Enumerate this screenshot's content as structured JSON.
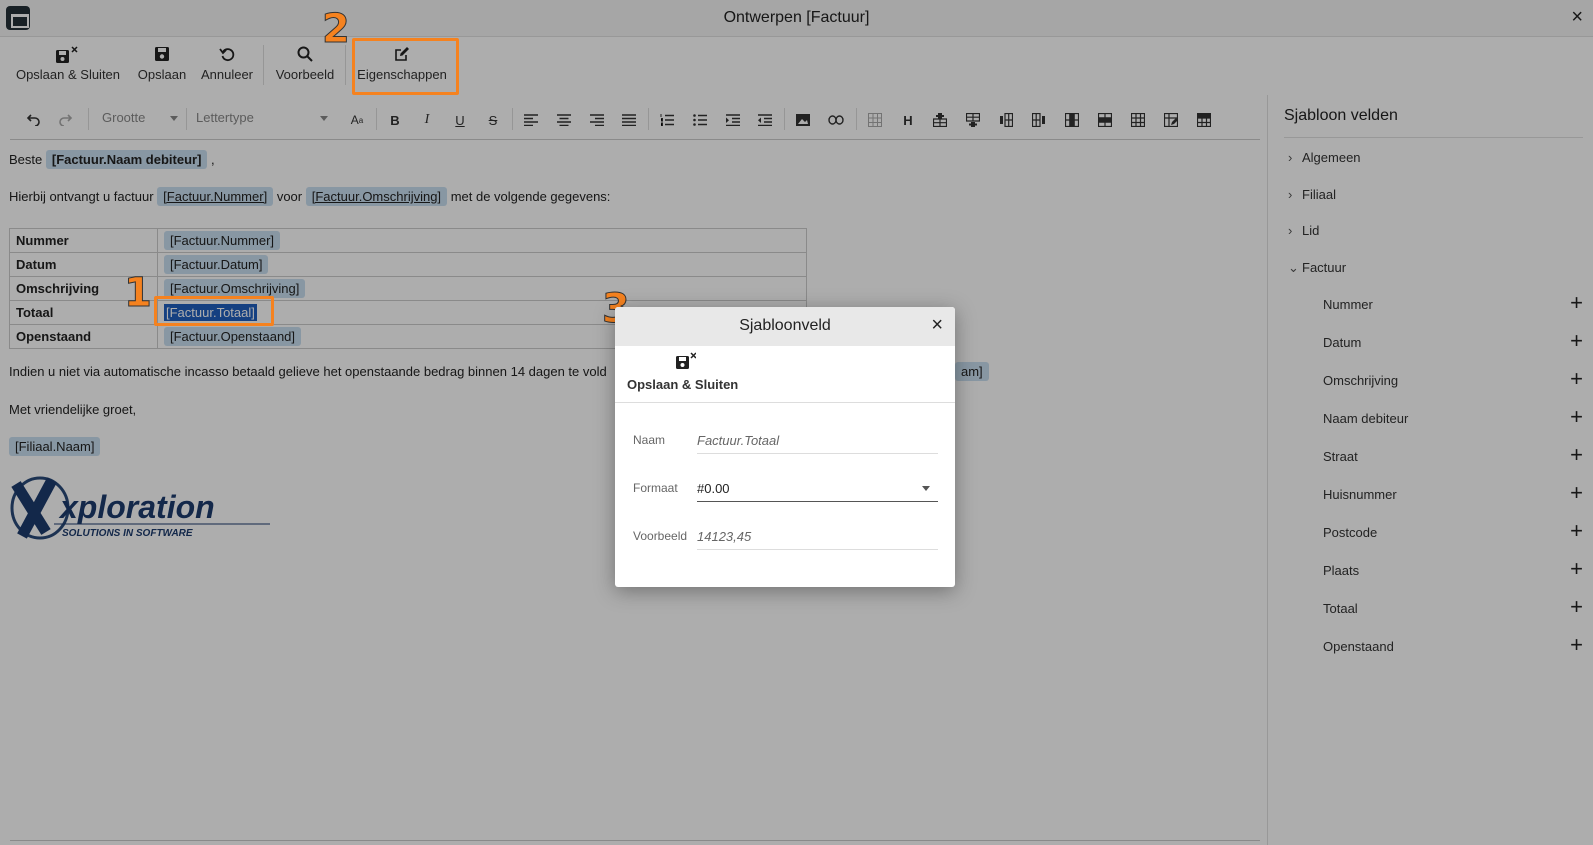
{
  "window": {
    "title": "Ontwerpen [Factuur]",
    "close": "×"
  },
  "toolbar": {
    "save_close": "Opslaan & Sluiten",
    "save": "Opslaan",
    "cancel": "Annuleer",
    "preview": "Voorbeeld",
    "properties": "Eigenschappen"
  },
  "editor": {
    "size_placeholder": "Grootte",
    "font_placeholder": "Lettertype"
  },
  "document": {
    "greeting": "Beste",
    "greeting_field": "[Factuur.Naam debiteur]",
    "greeting_end": ",",
    "line2_a": "Hierbij ontvangt u factuur",
    "line2_field1": "[Factuur.Nummer]",
    "line2_b": "voor",
    "line2_field2": "[Factuur.Omschrijving]",
    "line2_c": "met de volgende gegevens:",
    "table": [
      {
        "label": "Nummer",
        "field": "[Factuur.Nummer]"
      },
      {
        "label": "Datum",
        "field": "[Factuur.Datum]"
      },
      {
        "label": "Omschrijving",
        "field": "[Factuur.Omschrijving]"
      },
      {
        "label": "Totaal",
        "field": "[Factuur.Totaal]"
      },
      {
        "label": "Openstaand",
        "field": "[Factuur.Openstaand]"
      }
    ],
    "line3": "Indien u niet via automatische incasso betaald gelieve het openstaande bedrag binnen 14 dagen te vold",
    "line3_tail": "am]",
    "closing": "Met vriendelijke groet,",
    "signature_field": "[Filiaal.Naam]",
    "logo_name": "xploration",
    "logo_tagline": "SOLUTIONS IN SOFTWARE"
  },
  "panel": {
    "title": "Sjabloon velden",
    "groups": [
      "Algemeen",
      "Filiaal",
      "Lid",
      "Factuur"
    ],
    "fields": [
      "Nummer",
      "Datum",
      "Omschrijving",
      "Naam debiteur",
      "Straat",
      "Huisnummer",
      "Postcode",
      "Plaats",
      "Totaal",
      "Openstaand"
    ]
  },
  "annotations": {
    "n1": "1",
    "n2": "2",
    "n3": "3"
  },
  "dialog": {
    "title": "Sjabloonveld",
    "save_close": "Opslaan & Sluiten",
    "name_label": "Naam",
    "name_value": "Factuur.Totaal",
    "format_label": "Formaat",
    "format_value": "#0.00",
    "preview_label": "Voorbeeld",
    "preview_value": "14123,45"
  },
  "colors": {
    "highlight": "#f5821f",
    "chip": "#c9dff0",
    "selection": "#1f5fbf"
  }
}
